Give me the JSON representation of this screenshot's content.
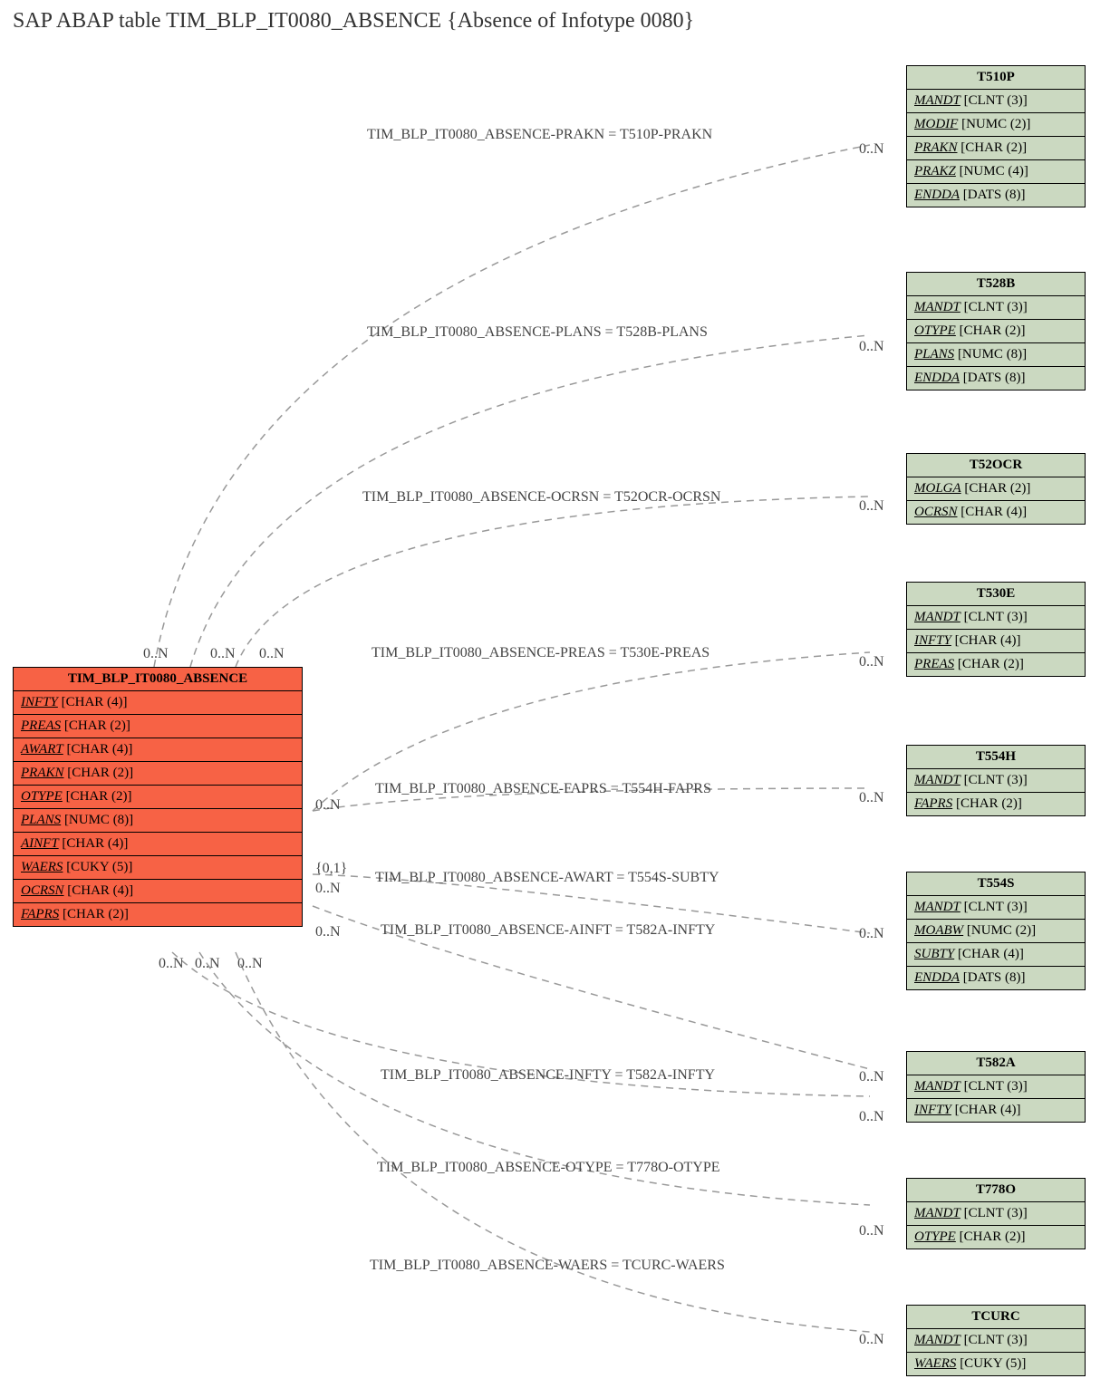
{
  "title": "SAP ABAP table TIM_BLP_IT0080_ABSENCE {Absence of Infotype 0080}",
  "main": {
    "name": "TIM_BLP_IT0080_ABSENCE",
    "rows": [
      {
        "n": "INFTY",
        "t": "[CHAR (4)]"
      },
      {
        "n": "PREAS",
        "t": "[CHAR (2)]"
      },
      {
        "n": "AWART",
        "t": "[CHAR (4)]"
      },
      {
        "n": "PRAKN",
        "t": "[CHAR (2)]"
      },
      {
        "n": "OTYPE",
        "t": "[CHAR (2)]"
      },
      {
        "n": "PLANS",
        "t": "[NUMC (8)]"
      },
      {
        "n": "AINFT",
        "t": "[CHAR (4)]"
      },
      {
        "n": "WAERS",
        "t": "[CUKY (5)]"
      },
      {
        "n": "OCRSN",
        "t": "[CHAR (4)]"
      },
      {
        "n": "FAPRS",
        "t": "[CHAR (2)]"
      }
    ]
  },
  "targets": [
    {
      "id": "t510p",
      "name": "T510P",
      "rows": [
        {
          "n": "MANDT",
          "t": "[CLNT (3)]"
        },
        {
          "n": "MODIF",
          "t": "[NUMC (2)]"
        },
        {
          "n": "PRAKN",
          "t": "[CHAR (2)]"
        },
        {
          "n": "PRAKZ",
          "t": "[NUMC (4)]"
        },
        {
          "n": "ENDDA",
          "t": "[DATS (8)]"
        }
      ]
    },
    {
      "id": "t528b",
      "name": "T528B",
      "rows": [
        {
          "n": "MANDT",
          "t": "[CLNT (3)]"
        },
        {
          "n": "OTYPE",
          "t": "[CHAR (2)]"
        },
        {
          "n": "PLANS",
          "t": "[NUMC (8)]"
        },
        {
          "n": "ENDDA",
          "t": "[DATS (8)]"
        }
      ]
    },
    {
      "id": "t52ocr",
      "name": "T52OCR",
      "rows": [
        {
          "n": "MOLGA",
          "t": "[CHAR (2)]"
        },
        {
          "n": "OCRSN",
          "t": "[CHAR (4)]"
        }
      ]
    },
    {
      "id": "t530e",
      "name": "T530E",
      "rows": [
        {
          "n": "MANDT",
          "t": "[CLNT (3)]"
        },
        {
          "n": "INFTY",
          "t": "[CHAR (4)]"
        },
        {
          "n": "PREAS",
          "t": "[CHAR (2)]"
        }
      ]
    },
    {
      "id": "t554h",
      "name": "T554H",
      "rows": [
        {
          "n": "MANDT",
          "t": "[CLNT (3)]"
        },
        {
          "n": "FAPRS",
          "t": "[CHAR (2)]"
        }
      ]
    },
    {
      "id": "t554s",
      "name": "T554S",
      "rows": [
        {
          "n": "MANDT",
          "t": "[CLNT (3)]"
        },
        {
          "n": "MOABW",
          "t": "[NUMC (2)]"
        },
        {
          "n": "SUBTY",
          "t": "[CHAR (4)]"
        },
        {
          "n": "ENDDA",
          "t": "[DATS (8)]"
        }
      ]
    },
    {
      "id": "t582a",
      "name": "T582A",
      "rows": [
        {
          "n": "MANDT",
          "t": "[CLNT (3)]"
        },
        {
          "n": "INFTY",
          "t": "[CHAR (4)]"
        }
      ]
    },
    {
      "id": "t778o",
      "name": "T778O",
      "rows": [
        {
          "n": "MANDT",
          "t": "[CLNT (3)]"
        },
        {
          "n": "OTYPE",
          "t": "[CHAR (2)]"
        }
      ]
    },
    {
      "id": "tcurc",
      "name": "TCURC",
      "rows": [
        {
          "n": "MANDT",
          "t": "[CLNT (3)]"
        },
        {
          "n": "WAERS",
          "t": "[CUKY (5)]"
        }
      ]
    }
  ],
  "rels": [
    {
      "text": "TIM_BLP_IT0080_ABSENCE-PRAKN = T510P-PRAKN"
    },
    {
      "text": "TIM_BLP_IT0080_ABSENCE-PLANS = T528B-PLANS"
    },
    {
      "text": "TIM_BLP_IT0080_ABSENCE-OCRSN = T52OCR-OCRSN"
    },
    {
      "text": "TIM_BLP_IT0080_ABSENCE-PREAS = T530E-PREAS"
    },
    {
      "text": "TIM_BLP_IT0080_ABSENCE-FAPRS = T554H-FAPRS"
    },
    {
      "text": "TIM_BLP_IT0080_ABSENCE-AWART = T554S-SUBTY"
    },
    {
      "text": "TIM_BLP_IT0080_ABSENCE-AINFT = T582A-INFTY"
    },
    {
      "text": "TIM_BLP_IT0080_ABSENCE-INFTY = T582A-INFTY"
    },
    {
      "text": "TIM_BLP_IT0080_ABSENCE-OTYPE = T778O-OTYPE"
    },
    {
      "text": "TIM_BLP_IT0080_ABSENCE-WAERS = TCURC-WAERS"
    }
  ],
  "cards": {
    "c0n": "0..N",
    "c01": "{0,1}"
  }
}
